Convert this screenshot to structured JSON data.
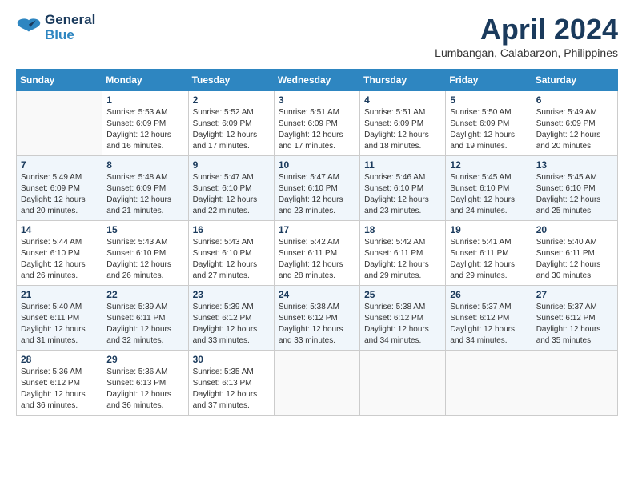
{
  "header": {
    "logo_line1": "General",
    "logo_line2": "Blue",
    "month_title": "April 2024",
    "location": "Lumbangan, Calabarzon, Philippines"
  },
  "weekdays": [
    "Sunday",
    "Monday",
    "Tuesday",
    "Wednesday",
    "Thursday",
    "Friday",
    "Saturday"
  ],
  "weeks": [
    [
      {
        "day": "",
        "sunrise": "",
        "sunset": "",
        "daylight": ""
      },
      {
        "day": "1",
        "sunrise": "Sunrise: 5:53 AM",
        "sunset": "Sunset: 6:09 PM",
        "daylight": "Daylight: 12 hours and 16 minutes."
      },
      {
        "day": "2",
        "sunrise": "Sunrise: 5:52 AM",
        "sunset": "Sunset: 6:09 PM",
        "daylight": "Daylight: 12 hours and 17 minutes."
      },
      {
        "day": "3",
        "sunrise": "Sunrise: 5:51 AM",
        "sunset": "Sunset: 6:09 PM",
        "daylight": "Daylight: 12 hours and 17 minutes."
      },
      {
        "day": "4",
        "sunrise": "Sunrise: 5:51 AM",
        "sunset": "Sunset: 6:09 PM",
        "daylight": "Daylight: 12 hours and 18 minutes."
      },
      {
        "day": "5",
        "sunrise": "Sunrise: 5:50 AM",
        "sunset": "Sunset: 6:09 PM",
        "daylight": "Daylight: 12 hours and 19 minutes."
      },
      {
        "day": "6",
        "sunrise": "Sunrise: 5:49 AM",
        "sunset": "Sunset: 6:09 PM",
        "daylight": "Daylight: 12 hours and 20 minutes."
      }
    ],
    [
      {
        "day": "7",
        "sunrise": "Sunrise: 5:49 AM",
        "sunset": "Sunset: 6:09 PM",
        "daylight": "Daylight: 12 hours and 20 minutes."
      },
      {
        "day": "8",
        "sunrise": "Sunrise: 5:48 AM",
        "sunset": "Sunset: 6:09 PM",
        "daylight": "Daylight: 12 hours and 21 minutes."
      },
      {
        "day": "9",
        "sunrise": "Sunrise: 5:47 AM",
        "sunset": "Sunset: 6:10 PM",
        "daylight": "Daylight: 12 hours and 22 minutes."
      },
      {
        "day": "10",
        "sunrise": "Sunrise: 5:47 AM",
        "sunset": "Sunset: 6:10 PM",
        "daylight": "Daylight: 12 hours and 23 minutes."
      },
      {
        "day": "11",
        "sunrise": "Sunrise: 5:46 AM",
        "sunset": "Sunset: 6:10 PM",
        "daylight": "Daylight: 12 hours and 23 minutes."
      },
      {
        "day": "12",
        "sunrise": "Sunrise: 5:45 AM",
        "sunset": "Sunset: 6:10 PM",
        "daylight": "Daylight: 12 hours and 24 minutes."
      },
      {
        "day": "13",
        "sunrise": "Sunrise: 5:45 AM",
        "sunset": "Sunset: 6:10 PM",
        "daylight": "Daylight: 12 hours and 25 minutes."
      }
    ],
    [
      {
        "day": "14",
        "sunrise": "Sunrise: 5:44 AM",
        "sunset": "Sunset: 6:10 PM",
        "daylight": "Daylight: 12 hours and 26 minutes."
      },
      {
        "day": "15",
        "sunrise": "Sunrise: 5:43 AM",
        "sunset": "Sunset: 6:10 PM",
        "daylight": "Daylight: 12 hours and 26 minutes."
      },
      {
        "day": "16",
        "sunrise": "Sunrise: 5:43 AM",
        "sunset": "Sunset: 6:10 PM",
        "daylight": "Daylight: 12 hours and 27 minutes."
      },
      {
        "day": "17",
        "sunrise": "Sunrise: 5:42 AM",
        "sunset": "Sunset: 6:11 PM",
        "daylight": "Daylight: 12 hours and 28 minutes."
      },
      {
        "day": "18",
        "sunrise": "Sunrise: 5:42 AM",
        "sunset": "Sunset: 6:11 PM",
        "daylight": "Daylight: 12 hours and 29 minutes."
      },
      {
        "day": "19",
        "sunrise": "Sunrise: 5:41 AM",
        "sunset": "Sunset: 6:11 PM",
        "daylight": "Daylight: 12 hours and 29 minutes."
      },
      {
        "day": "20",
        "sunrise": "Sunrise: 5:40 AM",
        "sunset": "Sunset: 6:11 PM",
        "daylight": "Daylight: 12 hours and 30 minutes."
      }
    ],
    [
      {
        "day": "21",
        "sunrise": "Sunrise: 5:40 AM",
        "sunset": "Sunset: 6:11 PM",
        "daylight": "Daylight: 12 hours and 31 minutes."
      },
      {
        "day": "22",
        "sunrise": "Sunrise: 5:39 AM",
        "sunset": "Sunset: 6:11 PM",
        "daylight": "Daylight: 12 hours and 32 minutes."
      },
      {
        "day": "23",
        "sunrise": "Sunrise: 5:39 AM",
        "sunset": "Sunset: 6:12 PM",
        "daylight": "Daylight: 12 hours and 33 minutes."
      },
      {
        "day": "24",
        "sunrise": "Sunrise: 5:38 AM",
        "sunset": "Sunset: 6:12 PM",
        "daylight": "Daylight: 12 hours and 33 minutes."
      },
      {
        "day": "25",
        "sunrise": "Sunrise: 5:38 AM",
        "sunset": "Sunset: 6:12 PM",
        "daylight": "Daylight: 12 hours and 34 minutes."
      },
      {
        "day": "26",
        "sunrise": "Sunrise: 5:37 AM",
        "sunset": "Sunset: 6:12 PM",
        "daylight": "Daylight: 12 hours and 34 minutes."
      },
      {
        "day": "27",
        "sunrise": "Sunrise: 5:37 AM",
        "sunset": "Sunset: 6:12 PM",
        "daylight": "Daylight: 12 hours and 35 minutes."
      }
    ],
    [
      {
        "day": "28",
        "sunrise": "Sunrise: 5:36 AM",
        "sunset": "Sunset: 6:12 PM",
        "daylight": "Daylight: 12 hours and 36 minutes."
      },
      {
        "day": "29",
        "sunrise": "Sunrise: 5:36 AM",
        "sunset": "Sunset: 6:13 PM",
        "daylight": "Daylight: 12 hours and 36 minutes."
      },
      {
        "day": "30",
        "sunrise": "Sunrise: 5:35 AM",
        "sunset": "Sunset: 6:13 PM",
        "daylight": "Daylight: 12 hours and 37 minutes."
      },
      {
        "day": "",
        "sunrise": "",
        "sunset": "",
        "daylight": ""
      },
      {
        "day": "",
        "sunrise": "",
        "sunset": "",
        "daylight": ""
      },
      {
        "day": "",
        "sunrise": "",
        "sunset": "",
        "daylight": ""
      },
      {
        "day": "",
        "sunrise": "",
        "sunset": "",
        "daylight": ""
      }
    ]
  ]
}
